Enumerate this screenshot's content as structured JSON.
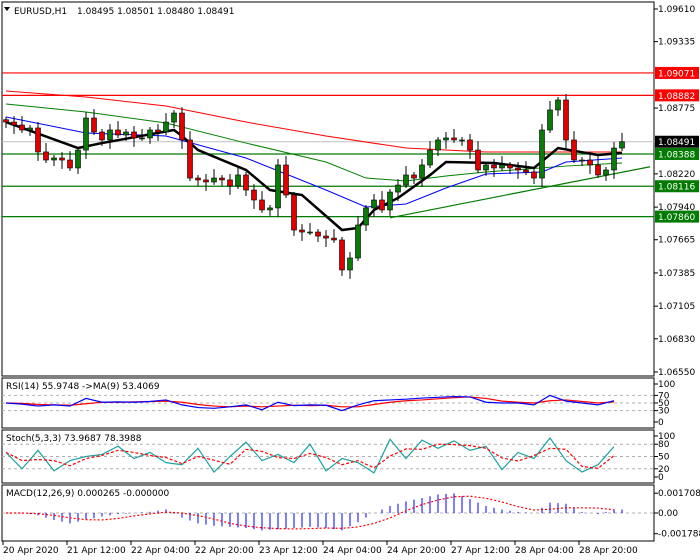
{
  "header": {
    "symbol": "EURUSD,H1",
    "ohlc": "1.08495 1.08501 1.08480 1.08491"
  },
  "colors": {
    "bull": "#0b7a0b",
    "bear": "#e00000",
    "ma_fast": "#000000",
    "ma_blue": "#0000ff",
    "ma_green": "#008000",
    "ma_red": "#ff0000",
    "support": "#007a00",
    "resistance": "#ff0000",
    "rsi": "#0000ff",
    "signal": "#ff0000",
    "stoch": "#20a0a0",
    "macd": "#0000ff"
  },
  "chart_data": {
    "type": "candlestick",
    "title": "EURUSD,H1",
    "ylim": [
      1.0655,
      1.0961
    ],
    "price_ticks": [
      "1.09610",
      "1.09335",
      "1.08775",
      "1.08220",
      "1.07940",
      "1.07665",
      "1.07385",
      "1.07105",
      "1.06830",
      "1.06550"
    ],
    "time_labels": [
      "20 Apr 2020",
      "21 Apr 12:00",
      "22 Apr 04:00",
      "22 Apr 20:00",
      "23 Apr 12:00",
      "24 Apr 04:00",
      "24 Apr 20:00",
      "27 Apr 12:00",
      "28 Apr 04:00",
      "28 Apr 20:00"
    ],
    "closes": [
      1.08657,
      1.08632,
      1.0859,
      1.08607,
      1.08405,
      1.08337,
      1.08354,
      1.08337,
      1.0827,
      1.08421,
      1.08691,
      1.08573,
      1.08506,
      1.0859,
      1.08548,
      1.08573,
      1.08523,
      1.08523,
      1.0859,
      1.08573,
      1.08657,
      1.08733,
      1.08506,
      1.08185,
      1.08169,
      1.08152,
      1.08185,
      1.08169,
      1.08118,
      1.08211,
      1.08084,
      1.08,
      1.07916,
      1.07933,
      1.08295,
      1.08042,
      1.07747,
      1.0773,
      1.0773,
      1.07696,
      1.07679,
      1.07663,
      1.0741,
      1.07511,
      1.07789,
      1.07933,
      1.08,
      1.07916,
      1.08067,
      1.08126,
      1.08211,
      1.08185,
      1.08295,
      1.08421,
      1.08506,
      1.08523,
      1.08506,
      1.08506,
      1.08421,
      1.08253,
      1.08295,
      1.0827,
      1.08295,
      1.0827,
      1.08253,
      1.08236,
      1.08185,
      1.0859,
      1.08759,
      1.08843,
      1.08506,
      1.08337,
      1.08337,
      1.08295,
      1.08211,
      1.08253,
      1.08438,
      1.08491
    ],
    "moving_averages": [
      {
        "name": "ma_red",
        "color_key": "ma_red",
        "points": [
          [
            0,
            1.08919
          ],
          [
            10,
            1.08868
          ],
          [
            20,
            1.08792
          ],
          [
            30,
            1.08657
          ],
          [
            40,
            1.08539
          ],
          [
            50,
            1.08438
          ],
          [
            60,
            1.08405
          ],
          [
            70,
            1.08405
          ],
          [
            77,
            1.08405
          ]
        ]
      },
      {
        "name": "ma_green",
        "color_key": "ma_green",
        "points": [
          [
            0,
            1.08809
          ],
          [
            10,
            1.08742
          ],
          [
            20,
            1.08649
          ],
          [
            30,
            1.0848
          ],
          [
            40,
            1.0832
          ],
          [
            45,
            1.08185
          ],
          [
            50,
            1.0816
          ],
          [
            55,
            1.08202
          ],
          [
            60,
            1.08236
          ],
          [
            70,
            1.08286
          ],
          [
            77,
            1.08312
          ]
        ]
      },
      {
        "name": "ma_blue",
        "color_key": "ma_blue",
        "points": [
          [
            0,
            1.087
          ],
          [
            10,
            1.08565
          ],
          [
            20,
            1.08539
          ],
          [
            30,
            1.08354
          ],
          [
            40,
            1.08084
          ],
          [
            45,
            1.07941
          ],
          [
            50,
            1.07966
          ],
          [
            55,
            1.08101
          ],
          [
            60,
            1.08219
          ],
          [
            67,
            1.08236
          ],
          [
            70,
            1.0832
          ],
          [
            77,
            1.08354
          ]
        ]
      },
      {
        "name": "ma_black",
        "color_key": "ma_fast",
        "points": [
          [
            0,
            1.08657
          ],
          [
            9,
            1.08438
          ],
          [
            12,
            1.0848
          ],
          [
            21,
            1.0859
          ],
          [
            22,
            1.08539
          ],
          [
            24,
            1.08421
          ],
          [
            30,
            1.08253
          ],
          [
            33,
            1.08084
          ],
          [
            37,
            1.08042
          ],
          [
            42,
            1.07747
          ],
          [
            44,
            1.07764
          ],
          [
            46,
            1.07916
          ],
          [
            49,
            1.08017
          ],
          [
            53,
            1.0821
          ],
          [
            55,
            1.0832
          ],
          [
            61,
            1.08312
          ],
          [
            66,
            1.0827
          ],
          [
            69,
            1.08438
          ],
          [
            74,
            1.08379
          ],
          [
            77,
            1.08396
          ]
        ]
      }
    ],
    "trendline": [
      [
        48,
        1.0785
      ],
      [
        80.5,
        1.0828
      ]
    ],
    "levels": [
      {
        "price": 1.09071,
        "label": "1.09071",
        "type": "resistance"
      },
      {
        "price": 1.08882,
        "label": "1.08882",
        "type": "resistance"
      },
      {
        "price": 1.08388,
        "label": "1.08388",
        "type": "support"
      },
      {
        "price": 1.08116,
        "label": "1.08116",
        "type": "support"
      },
      {
        "price": 1.0786,
        "label": "1.07860",
        "type": "support"
      }
    ],
    "current_price": {
      "price": 1.08491,
      "label": "1.08491"
    },
    "indicators": {
      "rsi": {
        "title": "RSI(14) 55.9748  ->MA(9) 53.4069",
        "range": [
          0,
          100
        ],
        "ticks": [
          "100",
          "70",
          "50",
          "30",
          "0"
        ],
        "tick_values": [
          100,
          70,
          50,
          30,
          0
        ],
        "levels": [
          70,
          50,
          30
        ],
        "values": [
          50,
          47,
          42,
          45,
          42,
          62,
          52,
          53,
          52,
          54,
          58,
          45,
          38,
          36,
          40,
          45,
          32,
          52,
          43,
          45,
          44,
          30,
          45,
          56,
          58,
          60,
          63,
          65,
          67,
          66,
          52,
          50,
          50,
          45,
          70,
          55,
          50,
          45,
          56
        ],
        "ma": [
          50,
          49,
          46,
          45,
          44,
          48,
          52,
          52,
          53,
          54,
          55,
          52,
          46,
          42,
          40,
          42,
          40,
          42,
          44,
          43,
          44,
          40,
          40,
          46,
          52,
          56,
          58,
          61,
          64,
          66,
          62,
          55,
          52,
          50,
          56,
          58,
          54,
          50,
          53
        ]
      },
      "stoch": {
        "title": "Stoch(5,3,3) 73.9687 78.3988",
        "range": [
          0,
          100
        ],
        "ticks": [
          "100",
          "80",
          "50",
          "20",
          "0"
        ],
        "tick_values": [
          100,
          80,
          50,
          20,
          0
        ],
        "levels": [
          80,
          50,
          20
        ],
        "values": [
          60,
          20,
          65,
          15,
          40,
          50,
          55,
          75,
          45,
          60,
          35,
          30,
          70,
          12,
          50,
          85,
          40,
          55,
          35,
          80,
          15,
          45,
          35,
          10,
          92,
          45,
          90,
          70,
          88,
          65,
          75,
          18,
          60,
          45,
          95,
          40,
          12,
          30,
          74
        ]
      },
      "macd": {
        "title": "MACD(12,26,9) 0.000265 -0.000000",
        "range": [
          -0.0019,
          0.0019
        ],
        "ticks": [
          "0.001708",
          "0.00",
          "-0.001788"
        ],
        "tick_values": [
          0.001708,
          0,
          -0.001788
        ],
        "values": [
          0,
          0,
          -0.0002,
          -0.0006,
          -0.0009,
          -0.0006,
          -0.0003,
          -0.0001,
          0,
          0.0001,
          0.0003,
          -0.0004,
          -0.0009,
          -0.0011,
          -0.0012,
          -0.0013,
          -0.0015,
          -0.0014,
          -0.0013,
          -0.0012,
          -0.0013,
          -0.0015,
          -0.0008,
          0,
          0.0006,
          0.001,
          0.0013,
          0.0016,
          0.0017,
          0.0012,
          0.0006,
          0.0003,
          0.0001,
          0,
          0.0009,
          0.0008,
          0.0001,
          -0.0001,
          0.0003
        ]
      }
    }
  }
}
